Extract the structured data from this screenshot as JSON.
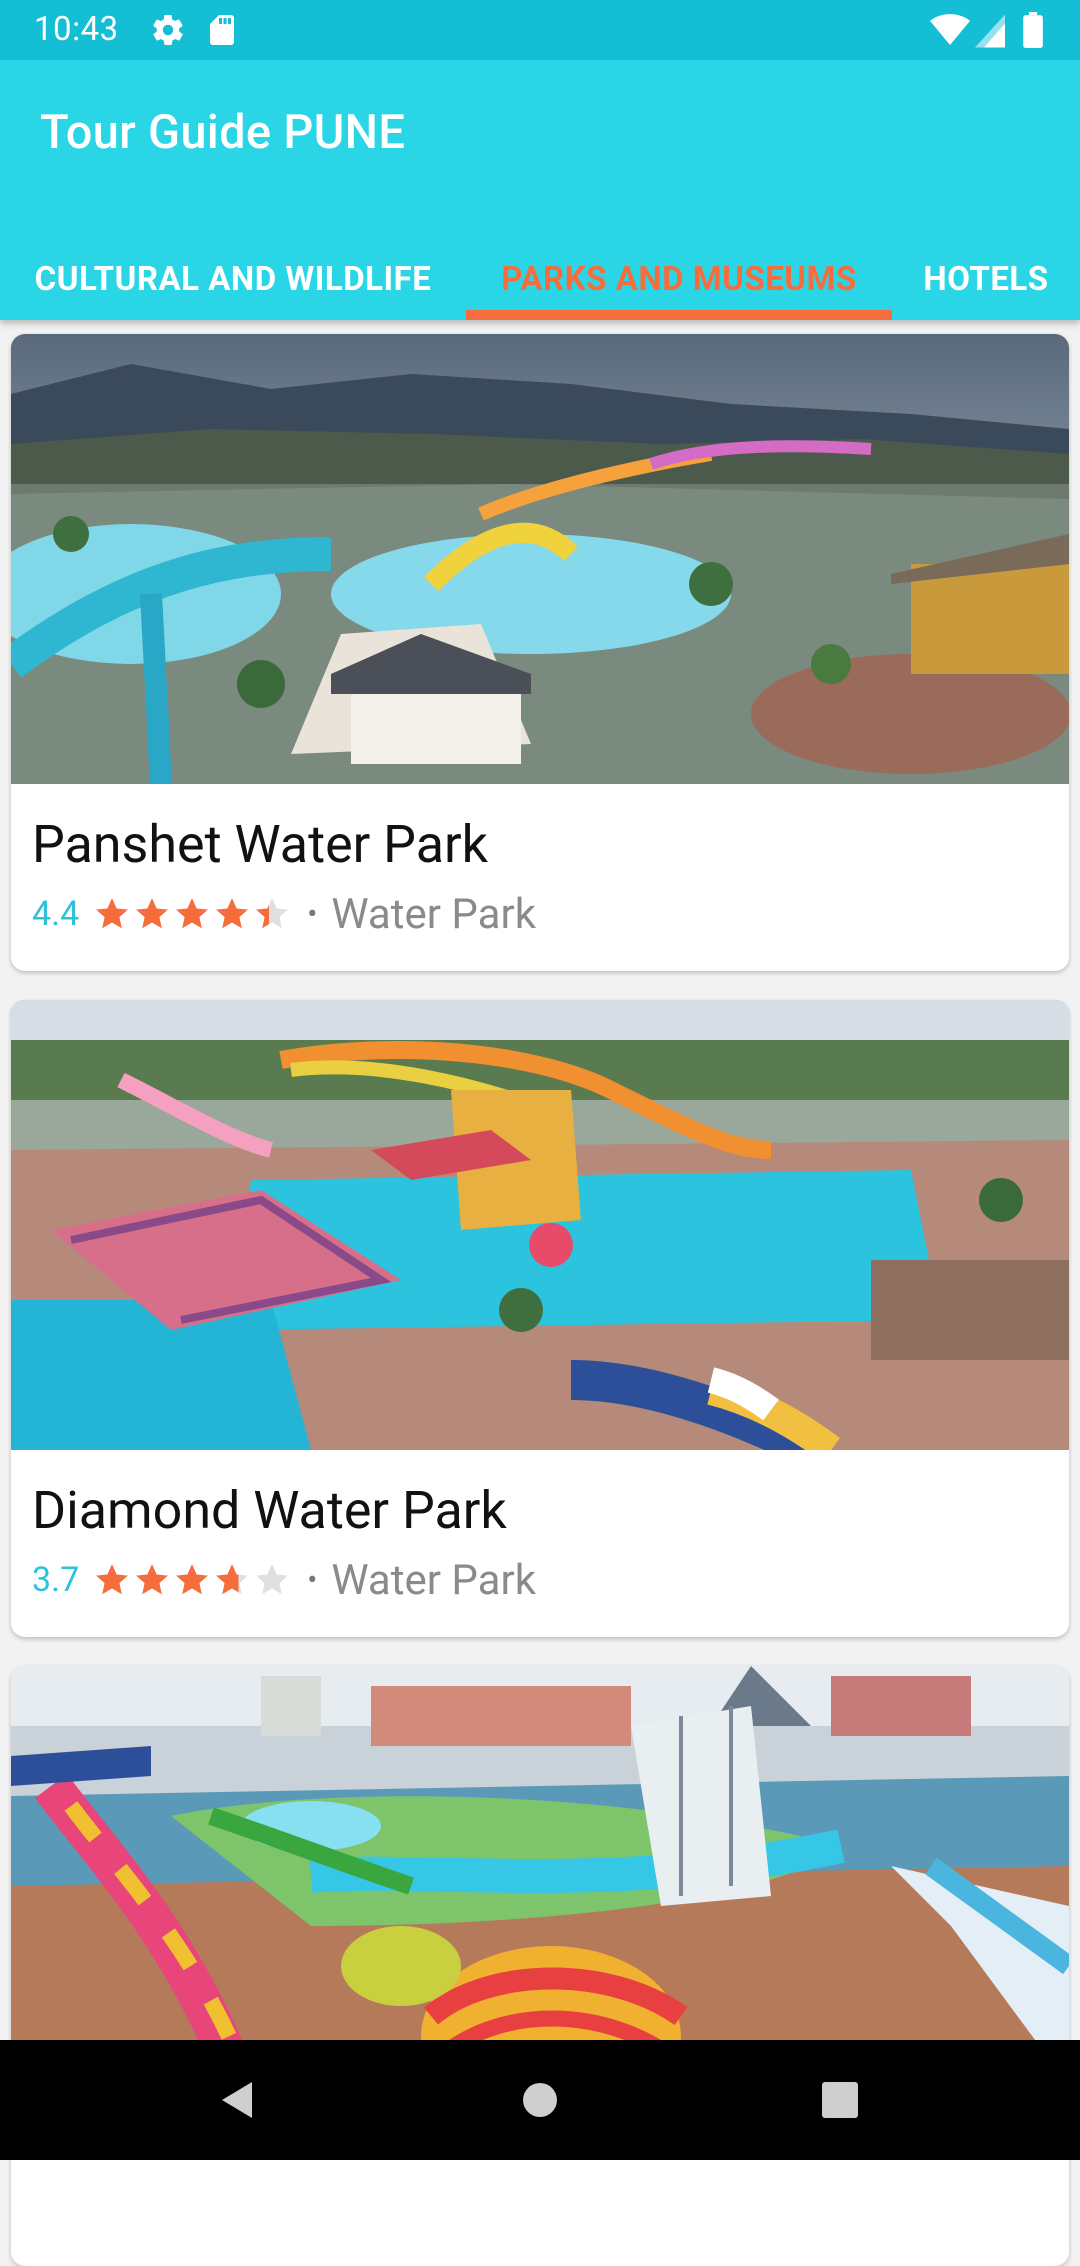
{
  "status_bar": {
    "time": "10:43",
    "icons": [
      "settings-icon",
      "sd-card-icon",
      "wifi-icon",
      "signal-icon",
      "battery-icon"
    ]
  },
  "app_bar": {
    "title": "Tour Guide PUNE",
    "tabs": [
      {
        "label": "CULTURAL AND WILDLIFE",
        "active": false
      },
      {
        "label": "PARKS AND MUSEUMS",
        "active": true
      },
      {
        "label": "HOTELS",
        "active": false
      }
    ]
  },
  "places": [
    {
      "name": "Panshet Water Park",
      "rating": "4.4",
      "stars": 4.4,
      "separator": "•",
      "category": "Water Park"
    },
    {
      "name": "Diamond Water Park",
      "rating": "3.7",
      "stars": 3.7,
      "separator": "•",
      "category": "Water Park"
    },
    {
      "name": "",
      "rating": "",
      "stars": 0,
      "separator": "",
      "category": ""
    }
  ],
  "colors": {
    "status_bar": "#14BFD6",
    "app_bar": "#2AD6E6",
    "accent": "#F56D3D",
    "rating_text": "#2BC3DA"
  },
  "navigation": {
    "icons": [
      "back-icon",
      "home-icon",
      "recents-icon"
    ]
  }
}
